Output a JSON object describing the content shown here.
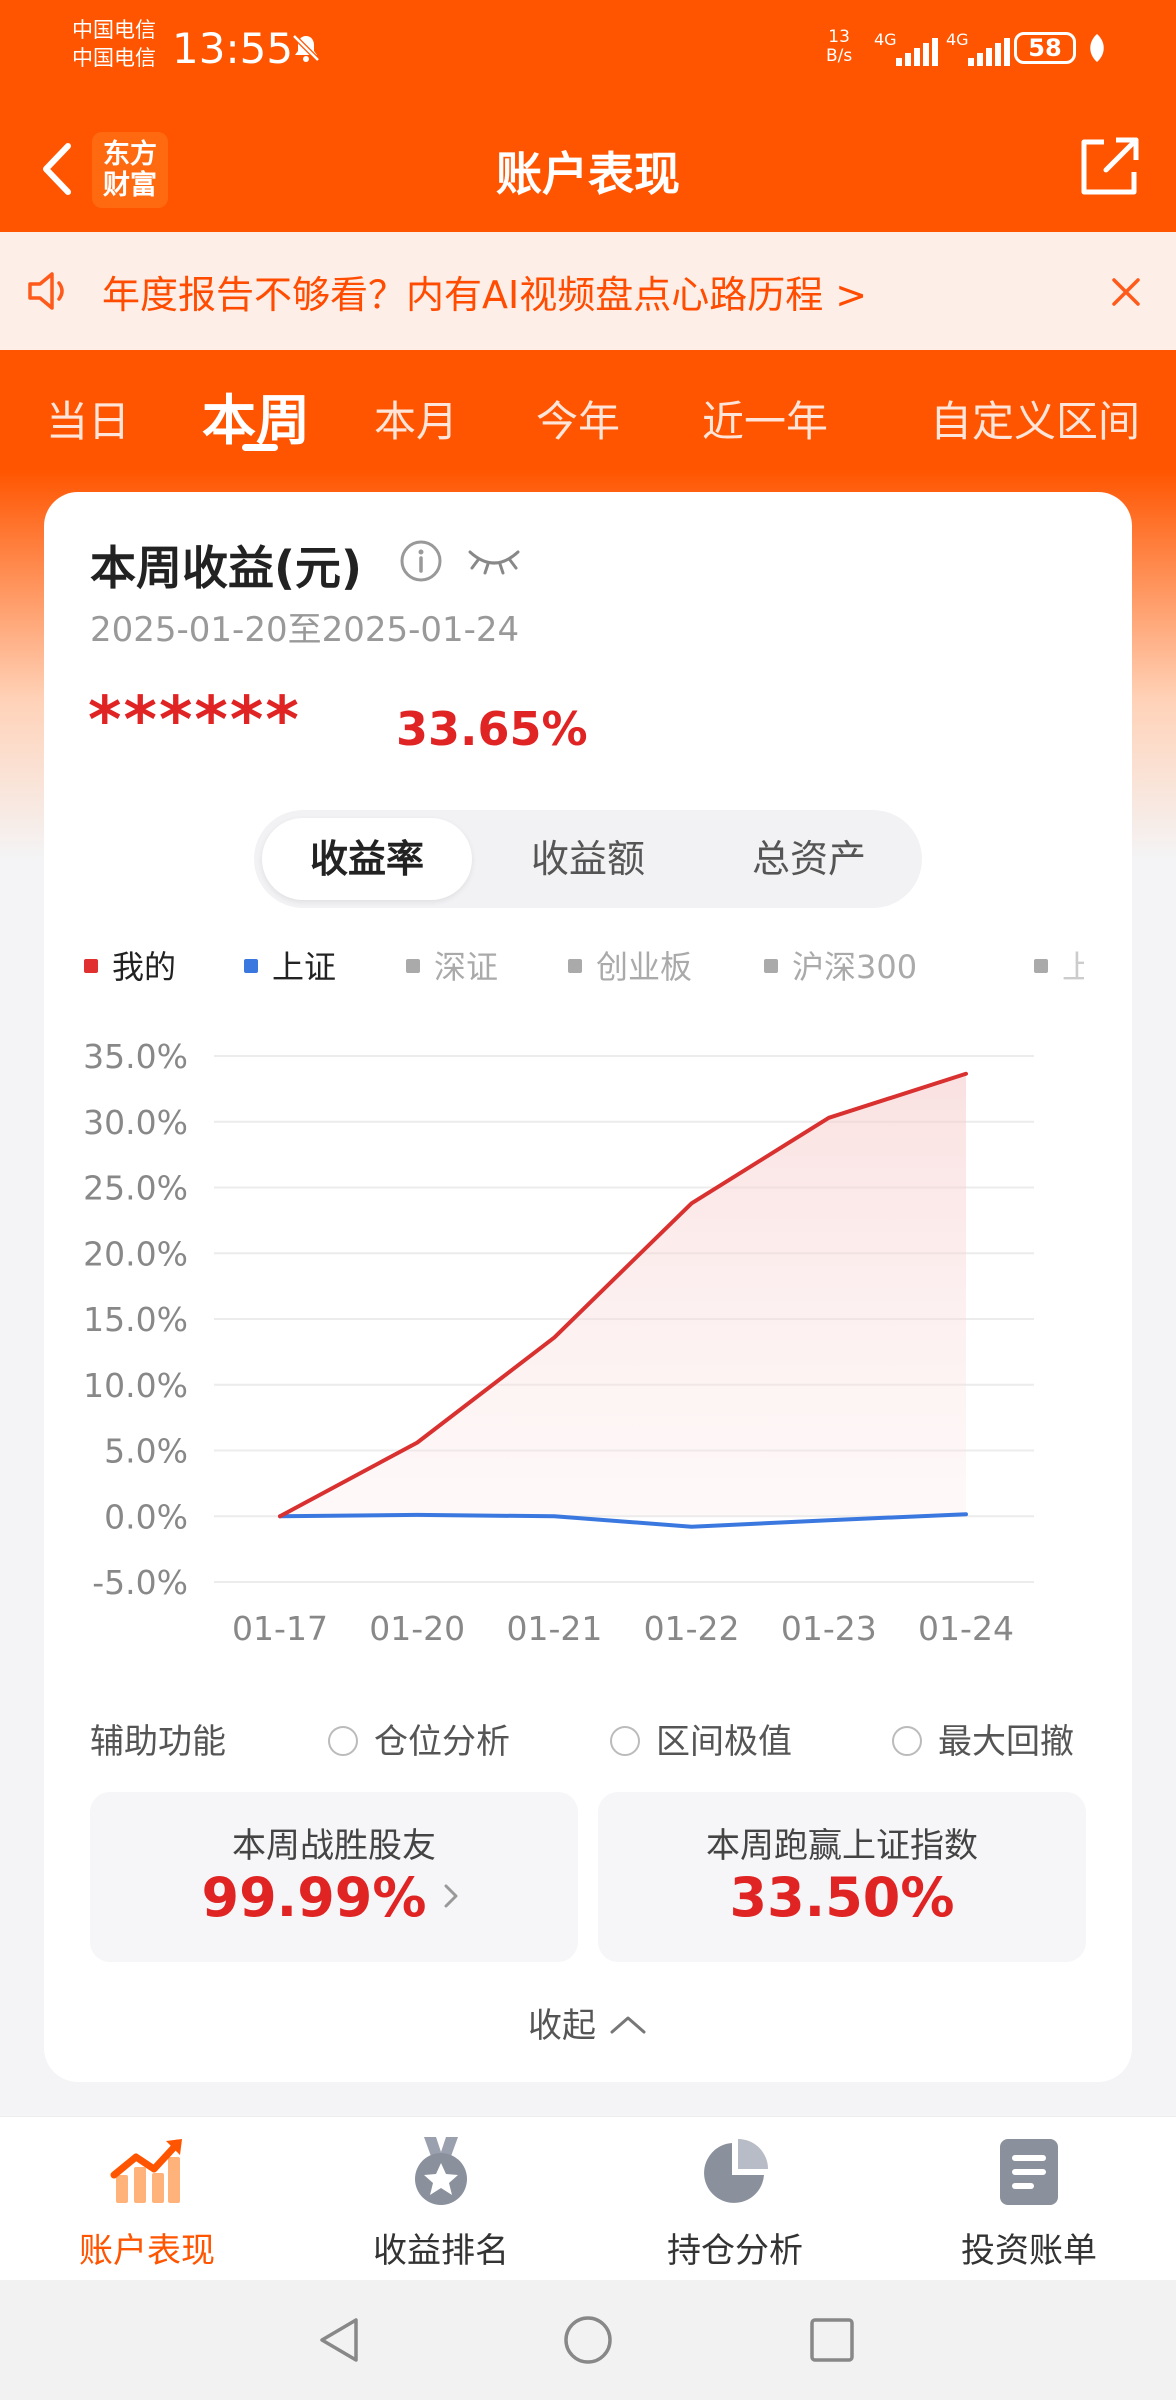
{
  "status_bar": {
    "carrier_1": "中国电信",
    "carrier_2": "中国电信",
    "time": "13:55",
    "net_speed_value": "13",
    "net_speed_unit": "B/s",
    "signal_1": "4G",
    "signal_2": "4G",
    "battery": "58"
  },
  "nav": {
    "logo_line1": "东方",
    "logo_line2": "财富",
    "title": "账户表现"
  },
  "notice": {
    "text": "年度报告不够看？内有AI视频盘点心路历程 >"
  },
  "period_tabs": [
    {
      "label": "当日"
    },
    {
      "label": "本周",
      "active": true
    },
    {
      "label": "本月"
    },
    {
      "label": "今年"
    },
    {
      "label": "近一年"
    },
    {
      "label": "自定义区间"
    }
  ],
  "card": {
    "title": "本周收益(元)",
    "date_range": "2025-01-20至2025-01-24",
    "masked_amount": "******",
    "return_pct": "33.65%",
    "segments": [
      {
        "label": "收益率",
        "active": true
      },
      {
        "label": "收益额"
      },
      {
        "label": "总资产"
      }
    ],
    "legend": [
      {
        "label": "我的",
        "color": "#e03030",
        "active": true
      },
      {
        "label": "上证",
        "color": "#3a78e0",
        "active": true
      },
      {
        "label": "深证",
        "color": "#aaaaaa"
      },
      {
        "label": "创业板",
        "color": "#aaaaaa"
      },
      {
        "label": "沪深300",
        "color": "#aaaaaa"
      },
      {
        "label": "上证",
        "color": "#aaaaaa"
      }
    ],
    "aux": {
      "label": "辅助功能",
      "options": [
        "仓位分析",
        "区间极值",
        "最大回撤"
      ]
    },
    "stats": [
      {
        "label": "本周战胜股友",
        "value": "99.99%"
      },
      {
        "label": "本周跑赢上证指数",
        "value": "33.50%"
      }
    ],
    "collapse_label": "收起"
  },
  "chart_data": {
    "type": "line",
    "x": [
      "01-17",
      "01-20",
      "01-21",
      "01-22",
      "01-23",
      "01-24"
    ],
    "yticks": [
      "35.0%",
      "30.0%",
      "25.0%",
      "20.0%",
      "15.0%",
      "10.0%",
      "5.0%",
      "0.0%",
      "-5.0%"
    ],
    "ylim": [
      -5,
      35
    ],
    "series": [
      {
        "name": "我的",
        "color": "#d93030",
        "values": [
          0.0,
          5.6,
          13.6,
          23.8,
          30.3,
          33.65
        ]
      },
      {
        "name": "上证",
        "color": "#3a78e0",
        "values": [
          0.0,
          0.1,
          0.0,
          -0.8,
          -0.3,
          0.15
        ]
      }
    ]
  },
  "bottom_nav": [
    {
      "label": "账户表现",
      "icon": "trend-chart-icon",
      "active": true
    },
    {
      "label": "收益排名",
      "icon": "medal-icon"
    },
    {
      "label": "持仓分析",
      "icon": "pie-chart-icon"
    },
    {
      "label": "投资账单",
      "icon": "document-icon"
    }
  ]
}
